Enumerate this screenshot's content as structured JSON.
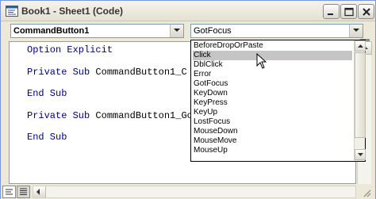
{
  "window": {
    "title": "Book1 - Sheet1 (Code)"
  },
  "object_combo": {
    "value": "CommandButton1"
  },
  "procedure_combo": {
    "value": "GotFocus"
  },
  "code_lines": [
    {
      "kw": "Option Explicit",
      "rest": ""
    },
    {
      "kw": "Private Sub ",
      "rest": "CommandButton1_C"
    },
    {
      "kw": "End Sub",
      "rest": ""
    },
    {
      "kw": "Private Sub ",
      "rest": "CommandButton1_Go"
    },
    {
      "kw": "End Sub",
      "rest": ""
    }
  ],
  "dropdown": {
    "items": [
      "BeforeDropOrPaste",
      "Click",
      "DblClick",
      "Error",
      "GotFocus",
      "KeyDown",
      "KeyPress",
      "KeyUp",
      "LostFocus",
      "MouseDown",
      "MouseMove",
      "MouseUp"
    ],
    "selected": "Click"
  },
  "colors": {
    "keyword": "#00007f",
    "selection": "#c5c5c5"
  }
}
